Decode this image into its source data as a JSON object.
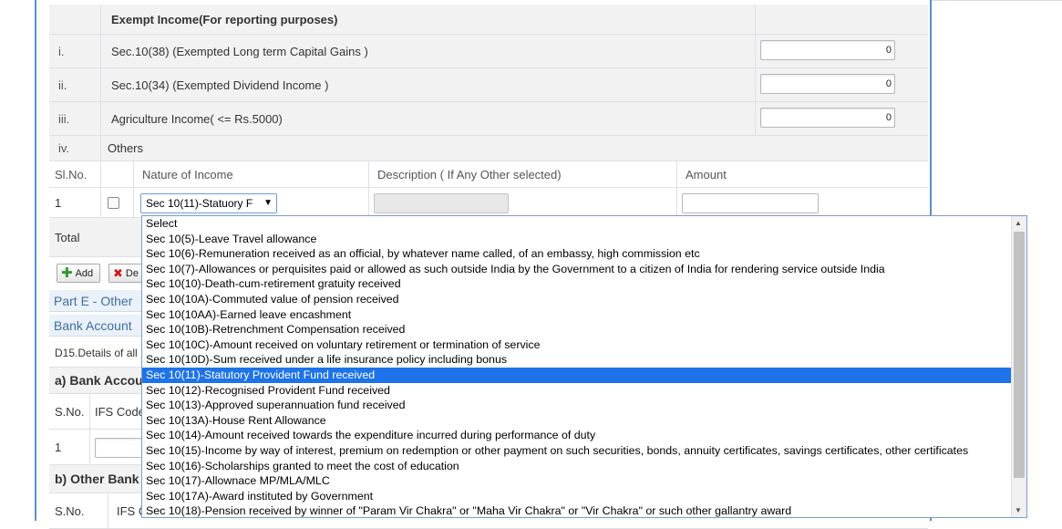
{
  "exempt": {
    "header": "Exempt Income(For reporting purposes)",
    "rows": [
      {
        "idx": "i.",
        "label": "Sec.10(38) (Exempted Long term Capital Gains )",
        "value": "0"
      },
      {
        "idx": "ii.",
        "label": "Sec.10(34) (Exempted Dividend Income )",
        "value": "0"
      },
      {
        "idx": "iii.",
        "label": "Agriculture Income( <= Rs.5000)",
        "value": "0"
      }
    ],
    "others_idx": "iv.",
    "others_label": "Others"
  },
  "others_table": {
    "headers": {
      "slno": "Sl.No.",
      "nature": "Nature of Income",
      "description": "Description ( If Any Other selected)",
      "amount": "Amount"
    },
    "row1_slno": "1",
    "selected_value": "Sec 10(11)-Statuory F",
    "arrow": "▼",
    "total_label": "Total"
  },
  "buttons": {
    "add": "Add",
    "delete": "De"
  },
  "sections": {
    "part_e": "Part E - Other",
    "bank_account": "Bank Account",
    "d15": "D15.Details of all",
    "a_bank": "a) Bank Accou",
    "sno": "S.No.",
    "ifs_code": "IFS Code",
    "row1": "1",
    "b_other": "b) Other Bank",
    "sno2": "S.No.",
    "ifs2": "IFS C"
  },
  "dropdown": {
    "selected_index": 10,
    "options": [
      "Select",
      "Sec 10(5)-Leave Travel allowance",
      "Sec 10(6)-Remuneration received as an official, by whatever name called, of an embassy, high commission etc",
      "Sec 10(7)-Allowances or perquisites paid or allowed as such outside India by the Government to a citizen of India for rendering service outside India",
      "Sec 10(10)-Death-cum-retirement gratuity received",
      "Sec 10(10A)-Commuted value of pension received",
      "Sec 10(10AA)-Earned leave encashment",
      "Sec 10(10B)-Retrenchment Compensation received",
      "Sec 10(10C)-Amount received on voluntary retirement or termination of service",
      "Sec 10(10D)-Sum received under a life insurance policy including bonus",
      "Sec 10(11)-Statutory Provident Fund received",
      "Sec 10(12)-Recognised Provident Fund received",
      "Sec 10(13)-Approved superannuation fund received",
      "Sec 10(13A)-House Rent Allowance",
      "Sec 10(14)-Amount received towards the expenditure incurred during performance of duty",
      "Sec 10(15)-Income by way of interest, premium on redemption or other payment on such securities, bonds, annuity certificates, savings certificates, other certificates",
      "Sec 10(16)-Scholarships granted to meet the cost of education",
      "Sec 10(17)-Allownace MP/MLA/MLC",
      "Sec 10(17A)-Award instituted by Government",
      "Sec 10(18)-Pension received by winner of \"Param Vir Chakra\" or \"Maha Vir Chakra\" or \"Vir Chakra\" or such other gallantry award"
    ]
  },
  "icons": {
    "add": "plus-icon",
    "delete": "x-icon",
    "scroll_up": "▲",
    "scroll_down": "▼"
  },
  "colors": {
    "frame": "#5d8ec8",
    "selected": "#1e73e8",
    "section_text": "#3e6ea5"
  }
}
